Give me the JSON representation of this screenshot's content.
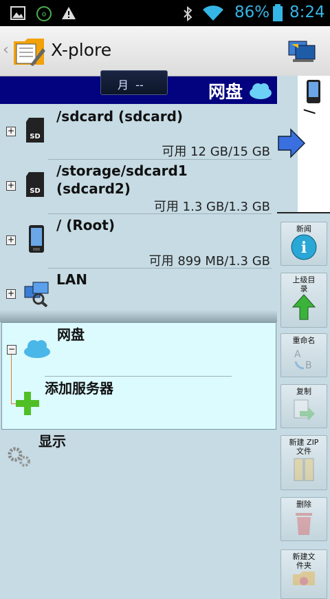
{
  "statusbar": {
    "battery_pct": "86%",
    "clock": "8:24"
  },
  "app": {
    "title": "X-plore"
  },
  "header": {
    "title": "网盘",
    "date_box": "月  --"
  },
  "list": {
    "items": [
      {
        "name": "/sdcard (sdcard)",
        "space": "可用 12 GB/15 GB"
      },
      {
        "name_line1": "/storage/sdcard1",
        "name_line2": "(sdcard2)",
        "space": "可用 1.3 GB/1.3 GB"
      },
      {
        "name": "/ (Root)",
        "space": "可用 899 MB/1.3 GB"
      },
      {
        "name": "LAN"
      },
      {
        "name": "网盘"
      },
      {
        "name": "添加服务器"
      },
      {
        "name": "显示"
      }
    ]
  },
  "right_panel": {
    "path_label": "/",
    "buttons": [
      {
        "label": "新闻"
      },
      {
        "label": "上级目录"
      },
      {
        "label": "重命名"
      },
      {
        "label": "复制"
      },
      {
        "label": "新建 ZIP 文件"
      },
      {
        "label": "删除"
      },
      {
        "label": "新建文件夹"
      }
    ]
  },
  "colors": {
    "header_bg": "#03037f",
    "list_bg": "#c6dbe4",
    "accent": "#35b5e5"
  }
}
